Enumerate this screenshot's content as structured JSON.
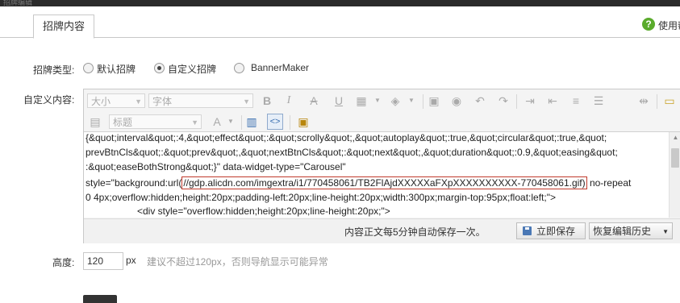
{
  "window": {
    "title": "招牌编辑"
  },
  "tabs": [
    {
      "label": "招牌内容"
    }
  ],
  "help": {
    "text": "使用帮"
  },
  "signboard_type": {
    "label": "招牌类型:",
    "options": [
      {
        "label": "默认招牌",
        "selected": false
      },
      {
        "label": "自定义招牌",
        "selected": true
      },
      {
        "label": "BannerMaker",
        "selected": false
      }
    ]
  },
  "custom_content": {
    "label": "自定义内容:"
  },
  "editor": {
    "font_size_select": "大小",
    "font_family_select": "字体",
    "heading_select": "标题",
    "toolbar_row1_icons": [
      "bold-icon",
      "italic-icon",
      "strikethrough-icon",
      "underline-icon",
      "table-icon",
      "fill-color-icon",
      "image-icon",
      "media-icon",
      "undo-icon",
      "redo-icon",
      "indent-icon",
      "outdent-icon",
      "align-icon",
      "justify-icon",
      "link-icon"
    ],
    "content_lines": [
      "{&quot;interval&quot;:4,&quot;effect&quot;:&quot;scrolly&quot;,&quot;autoplay&quot;:true,&quot;circular&quot;:true,&quot;",
      "prevBtnCls&quot;:&quot;prev&quot;,&quot;nextBtnCls&quot;:&quot;next&quot;,&quot;duration&quot;:0.9,&quot;easing&quot;",
      ":&quot;easeBothStrong&quot;}\" data-widget-type=\"Carousel\""
    ],
    "style_line_prefix": "style=\"background:url(",
    "highlighted_url": "//gdp.alicdn.com/imgextra/i1/770458061/TB2FlAjdXXXXXaFXpXXXXXXXXXX-770458061.gif)",
    "style_line_suffix": " no-repeat",
    "content_line_5": "0 4px;overflow:hidden;height:20px;padding-left:20px;line-height:20px;width:300px;margin-top:95px;float:left;\">",
    "content_line_6": "<div style=\"overflow:hidden;height:20px;line-height:20px;\">",
    "autosave_text": "内容正文每5分钟自动保存一次。",
    "save_now_label": "立即保存",
    "restore_history_label": "恢复编辑历史"
  },
  "height": {
    "label": "高度:",
    "value": "120",
    "unit": "px",
    "hint": "建议不超过120px，否则导航显示可能异常"
  },
  "colors": {
    "highlight_border": "#c0392b",
    "help_icon": "#5aab2c"
  }
}
